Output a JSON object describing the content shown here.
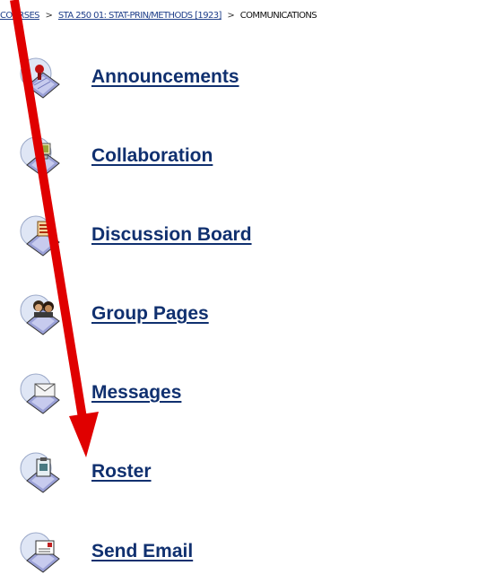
{
  "breadcrumb": {
    "courses_label": "COURSES",
    "separator": ">",
    "course_label": "STA 250 01: STAT-PRIN/METHODS [1923]",
    "current_label": "COMMUNICATIONS"
  },
  "tools": [
    {
      "label": "Announcements",
      "icon": "announcements-icon"
    },
    {
      "label": "Collaboration",
      "icon": "collaboration-icon"
    },
    {
      "label": "Discussion Board",
      "icon": "discussion-board-icon"
    },
    {
      "label": "Group Pages",
      "icon": "group-pages-icon"
    },
    {
      "label": "Messages",
      "icon": "messages-icon"
    },
    {
      "label": "Roster",
      "icon": "roster-icon"
    },
    {
      "label": "Send Email",
      "icon": "send-email-icon"
    }
  ],
  "colors": {
    "link": "#10306f",
    "arrow": "#e00000"
  }
}
